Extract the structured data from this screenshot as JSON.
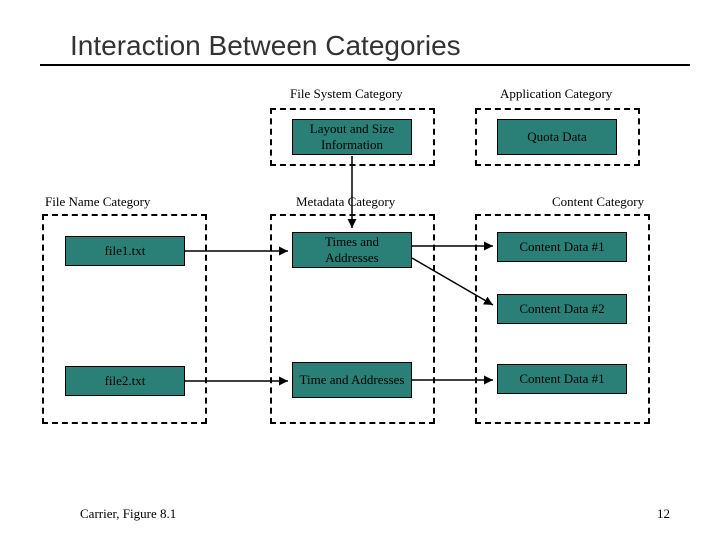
{
  "title": "Interaction Between Categories",
  "labels": {
    "fileSystem": "File System Category",
    "application": "Application Category",
    "fileName": "File Name Category",
    "metadata": "Metadata   Category",
    "content": "Content Category"
  },
  "boxes": {
    "layoutSize": "Layout and Size Information",
    "quotaData": "Quota Data",
    "file1": "file1.txt",
    "file2": "file2.txt",
    "times1": "Times and Addresses",
    "times2": "Time and Addresses",
    "content1a": "Content Data #1",
    "content2": "Content Data #2",
    "content1b": "Content Data #1"
  },
  "footer": {
    "caption": "Carrier, Figure 8.1",
    "page": "12"
  }
}
